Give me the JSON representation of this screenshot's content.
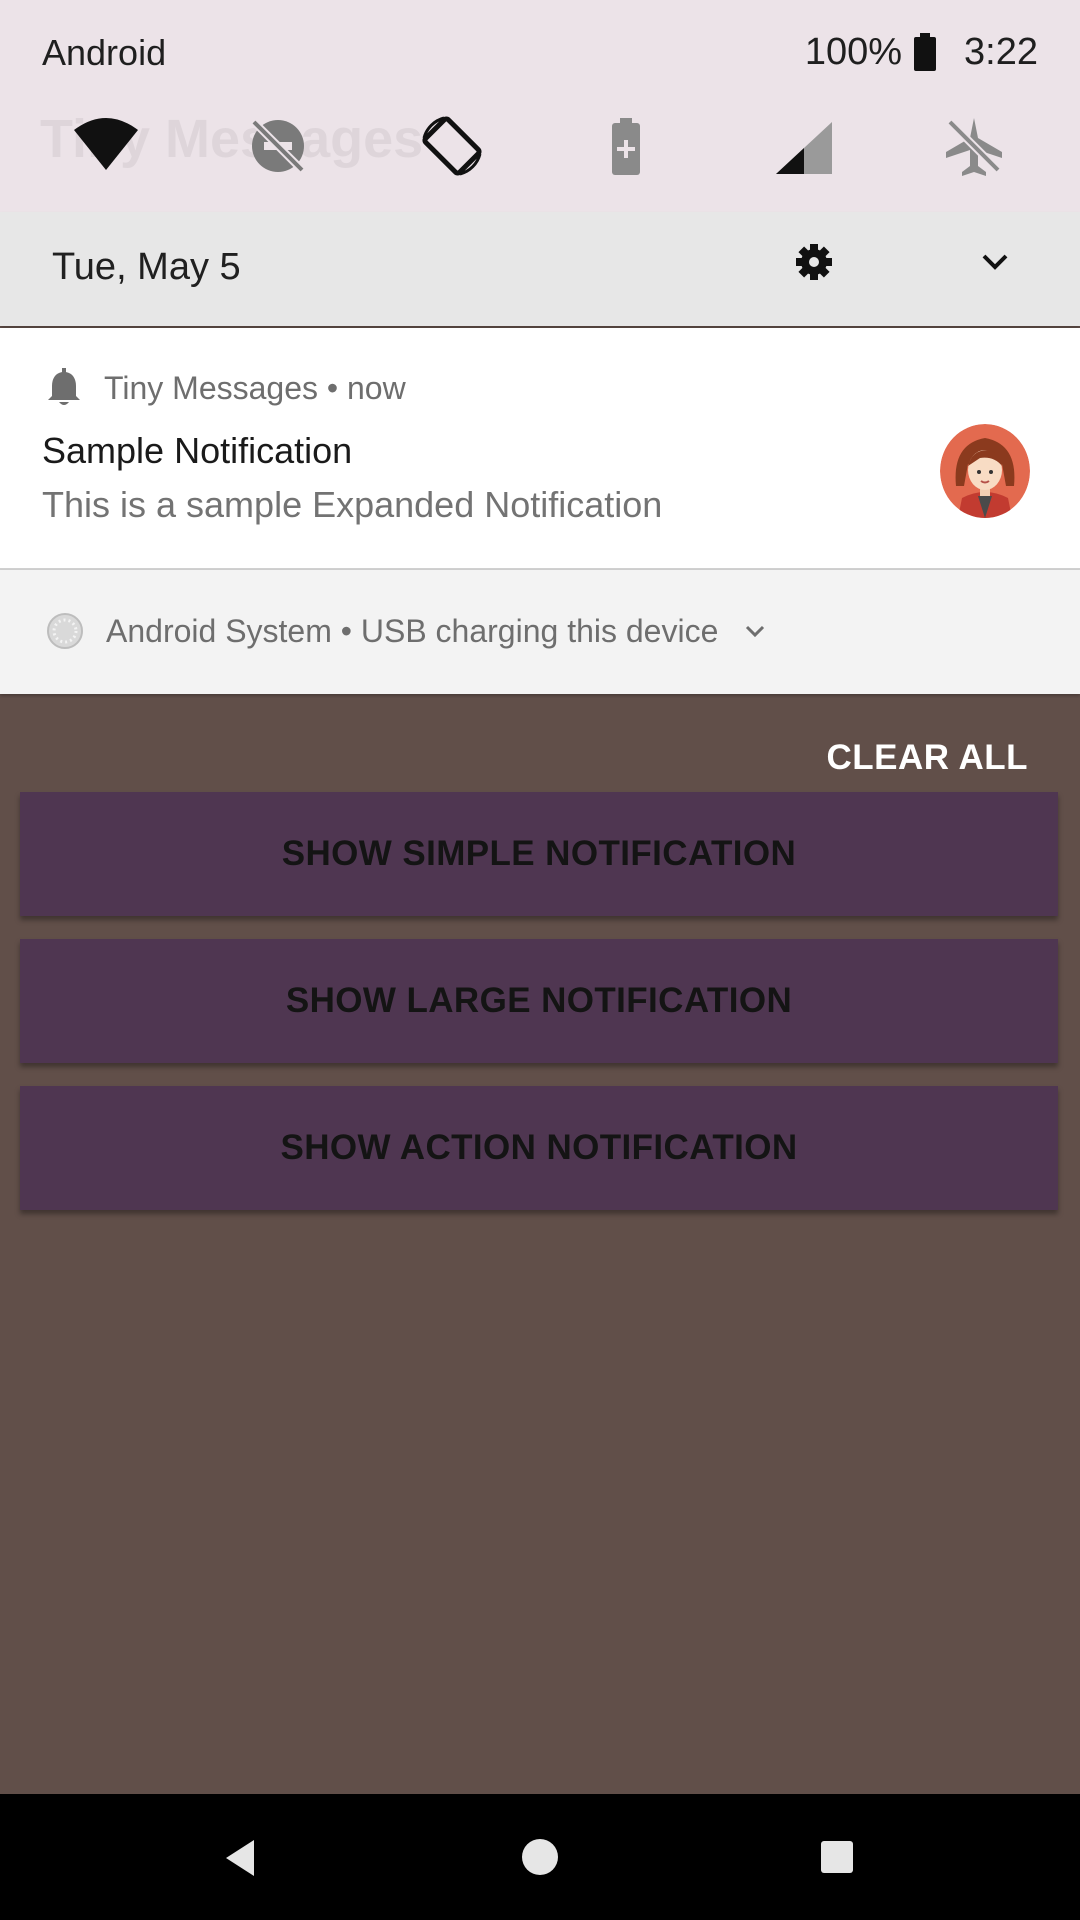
{
  "status_bar": {
    "carrier": "Android",
    "battery_percent": "100%",
    "time": "3:22"
  },
  "background_app_title": "Tiny Messages",
  "quick_settings": {
    "tiles": [
      "wifi-icon",
      "do-not-disturb-off-icon",
      "auto-rotate-icon",
      "battery-saver-icon",
      "cellular-signal-icon",
      "airplane-mode-off-icon"
    ],
    "date": "Tue, May 5"
  },
  "notification": {
    "app_name": "Tiny Messages",
    "time": "now",
    "separator": "•",
    "title": "Sample Notification",
    "body": "This is a sample Expanded Notification"
  },
  "system_notification": {
    "app_name": "Android System",
    "separator": "•",
    "text": "USB charging this device"
  },
  "clear_all_label": "CLEAR ALL",
  "buttons": {
    "simple": "SHOW SIMPLE NOTIFICATION",
    "large": "SHOW LARGE NOTIFICATION",
    "action": "SHOW ACTION NOTIFICATION"
  },
  "colors": {
    "app_background": "#614f49",
    "button_background": "#4f3651",
    "shade_background": "#ece3e8"
  }
}
